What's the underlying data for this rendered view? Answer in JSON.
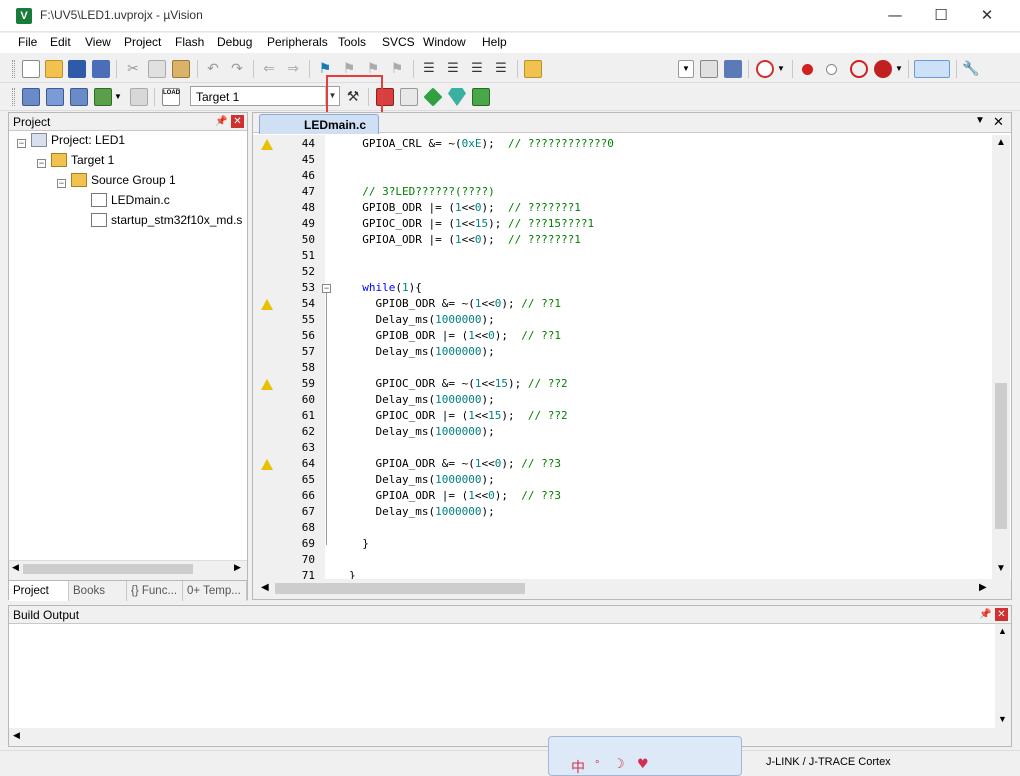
{
  "window": {
    "title": "F:\\UV5\\LED1.uvprojx - µVision",
    "app_icon": "V",
    "minimize": "—",
    "maximize": "☐",
    "close": "✕"
  },
  "menu": [
    "File",
    "Edit",
    "View",
    "Project",
    "Flash",
    "Debug",
    "Peripherals",
    "Tools",
    "SVCS",
    "Window",
    "Help"
  ],
  "build_toolbar": {
    "target": "Target 1"
  },
  "project_panel": {
    "title": "Project",
    "tree": {
      "project": "Project: LED1",
      "target": "Target 1",
      "group": "Source Group 1",
      "files": [
        "LEDmain.c",
        "startup_stm32f10x_md.s"
      ]
    },
    "tabs": [
      "Project",
      "Books",
      "{} Func...",
      "0+ Temp..."
    ]
  },
  "editor": {
    "tab": "LEDmain.c",
    "lines": [
      {
        "n": "44",
        "t": "  GPIOA_CRL &= ~(0xE);  // ????????????0",
        "warn": true
      },
      {
        "n": "45",
        "t": ""
      },
      {
        "n": "46",
        "t": ""
      },
      {
        "n": "47",
        "t": "  // 3?LED??????(????)"
      },
      {
        "n": "48",
        "t": "  GPIOB_ODR |= (1<<0);  // ???????1"
      },
      {
        "n": "49",
        "t": "  GPIOC_ODR |= (1<<15); // ???15????1"
      },
      {
        "n": "50",
        "t": "  GPIOA_ODR |= (1<<0);  // ???????1"
      },
      {
        "n": "51",
        "t": ""
      },
      {
        "n": "52",
        "t": ""
      },
      {
        "n": "53",
        "t": "  while(1){",
        "fold": true
      },
      {
        "n": "54",
        "t": "    GPIOB_ODR &= ~(1<<0); // ??1",
        "warn": true
      },
      {
        "n": "55",
        "t": "    Delay_ms(1000000);"
      },
      {
        "n": "56",
        "t": "    GPIOB_ODR |= (1<<0);  // ??1"
      },
      {
        "n": "57",
        "t": "    Delay_ms(1000000);"
      },
      {
        "n": "58",
        "t": ""
      },
      {
        "n": "59",
        "t": "    GPIOC_ODR &= ~(1<<15); // ??2",
        "warn": true
      },
      {
        "n": "60",
        "t": "    Delay_ms(1000000);"
      },
      {
        "n": "61",
        "t": "    GPIOC_ODR |= (1<<15);  // ??2"
      },
      {
        "n": "62",
        "t": "    Delay_ms(1000000);"
      },
      {
        "n": "63",
        "t": ""
      },
      {
        "n": "64",
        "t": "    GPIOA_ODR &= ~(1<<0); // ??3",
        "warn": true
      },
      {
        "n": "65",
        "t": "    Delay_ms(1000000);"
      },
      {
        "n": "66",
        "t": "    GPIOA_ODR |= (1<<0);  // ??3"
      },
      {
        "n": "67",
        "t": "    Delay_ms(1000000);"
      },
      {
        "n": "68",
        "t": ""
      },
      {
        "n": "69",
        "t": "  }"
      },
      {
        "n": "70",
        "t": ""
      },
      {
        "n": "71",
        "t": "}"
      }
    ]
  },
  "build_output": {
    "title": "Build Output"
  },
  "status": {
    "debugger": "J-LINK / J-TRACE Cortex"
  },
  "ime": {
    "label": "中"
  },
  "colors": {
    "keyword": "#0000ff",
    "number": "#008080",
    "comment": "#008000",
    "highlight": "#e04040",
    "warning": "#e8c000"
  }
}
